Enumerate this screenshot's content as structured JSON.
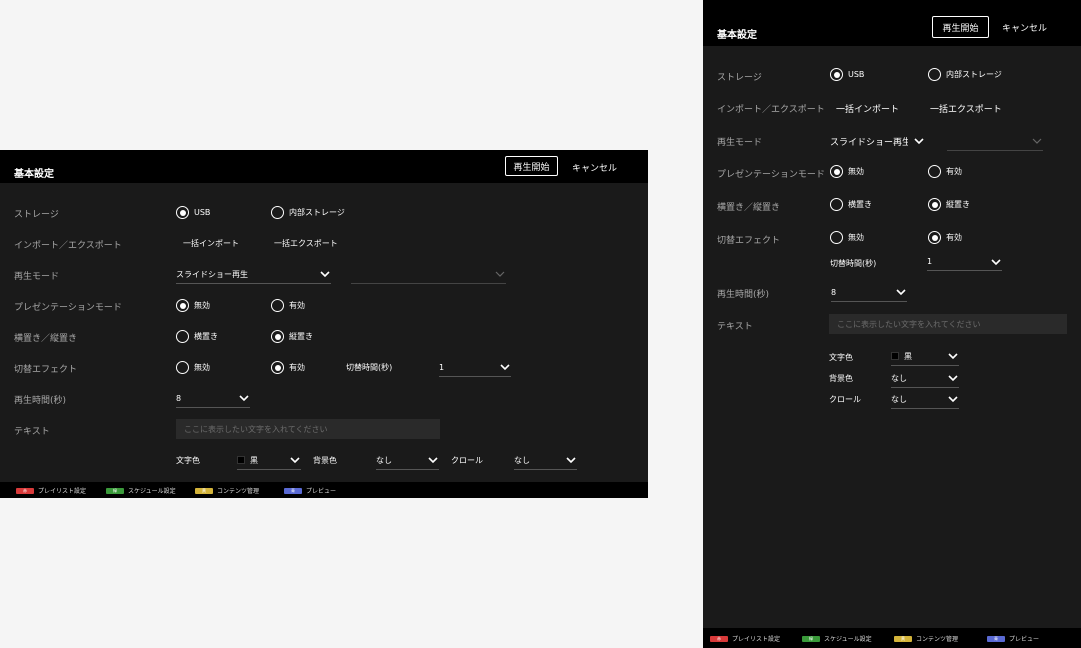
{
  "header": {
    "title": "基本設定",
    "start_label": "再生開始",
    "cancel_label": "キャンセル"
  },
  "storage": {
    "label": "ストレージ",
    "opt1": "USB",
    "opt2": "内部ストレージ",
    "selected": "USB"
  },
  "import_export": {
    "label": "インポート／エクスポート",
    "import_label": "一括インポート",
    "export_label": "一括エクスポート"
  },
  "play_mode": {
    "label": "再生モード",
    "value": "スライドショー再生",
    "value_narrow": "スライドショー再生"
  },
  "presentation": {
    "label": "プレゼンテーションモード",
    "opt1": "無効",
    "opt2": "有効",
    "selected": "無効"
  },
  "orientation": {
    "label": "横置き／縦置き",
    "opt1": "横置き",
    "opt2": "縦置き",
    "selected": "縦置き"
  },
  "effect": {
    "label": "切替エフェクト",
    "opt1": "無効",
    "opt2": "有効",
    "selected": "有効",
    "switch_time_label": "切替時間(秒)",
    "switch_time_value": "1"
  },
  "play_time": {
    "label": "再生時間(秒)",
    "value": "8"
  },
  "text": {
    "label": "テキスト",
    "placeholder": "ここに表示したい文字を入れてください",
    "color_label": "文字色",
    "color_value": "黒",
    "bg_label": "背景色",
    "bg_value": "なし",
    "scroll_label": "クロール",
    "scroll_value": "なし"
  },
  "footer": {
    "items": [
      {
        "key": "赤",
        "label": "プレイリスト設定",
        "color": "#d93a3a"
      },
      {
        "key": "緑",
        "label": "スケジュール設定",
        "color": "#3a9a3a"
      },
      {
        "key": "黄",
        "label": "コンテンツ管理",
        "color": "#d4b43a"
      },
      {
        "key": "青",
        "label": "プレビュー",
        "color": "#5a6ad4"
      }
    ]
  }
}
